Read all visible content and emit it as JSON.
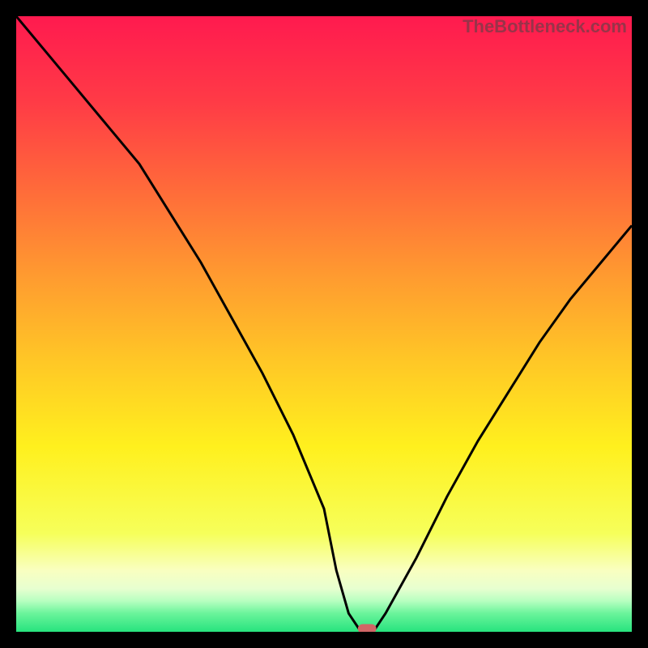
{
  "watermark": "TheBottleneck.com",
  "chart_data": {
    "type": "line",
    "title": "",
    "xlabel": "",
    "ylabel": "",
    "xlim": [
      0,
      100
    ],
    "ylim": [
      0,
      100
    ],
    "x": [
      0,
      5,
      10,
      15,
      20,
      25,
      30,
      35,
      40,
      45,
      50,
      52,
      54,
      56,
      58,
      60,
      65,
      70,
      75,
      80,
      85,
      90,
      95,
      100
    ],
    "values": [
      100,
      94,
      88,
      82,
      76,
      68,
      60,
      51,
      42,
      32,
      20,
      10,
      3,
      0,
      0,
      3,
      12,
      22,
      31,
      39,
      47,
      54,
      60,
      66
    ],
    "series": [
      {
        "name": "curve",
        "type": "line",
        "color": "#000000"
      }
    ],
    "marker": {
      "x": 57,
      "y": 0.5,
      "color": "#d16666",
      "width": 3,
      "height": 1.5
    },
    "gradient_stops": [
      {
        "offset": 0,
        "color": "#ff1a4f"
      },
      {
        "offset": 14,
        "color": "#ff3b46"
      },
      {
        "offset": 28,
        "color": "#ff6a3a"
      },
      {
        "offset": 42,
        "color": "#ff9a30"
      },
      {
        "offset": 56,
        "color": "#ffc726"
      },
      {
        "offset": 70,
        "color": "#fff01e"
      },
      {
        "offset": 84,
        "color": "#f6ff5a"
      },
      {
        "offset": 90,
        "color": "#f9ffc0"
      },
      {
        "offset": 93,
        "color": "#e7ffd0"
      },
      {
        "offset": 95,
        "color": "#b7ffc0"
      },
      {
        "offset": 97,
        "color": "#6bf49b"
      },
      {
        "offset": 100,
        "color": "#27e37e"
      }
    ]
  }
}
